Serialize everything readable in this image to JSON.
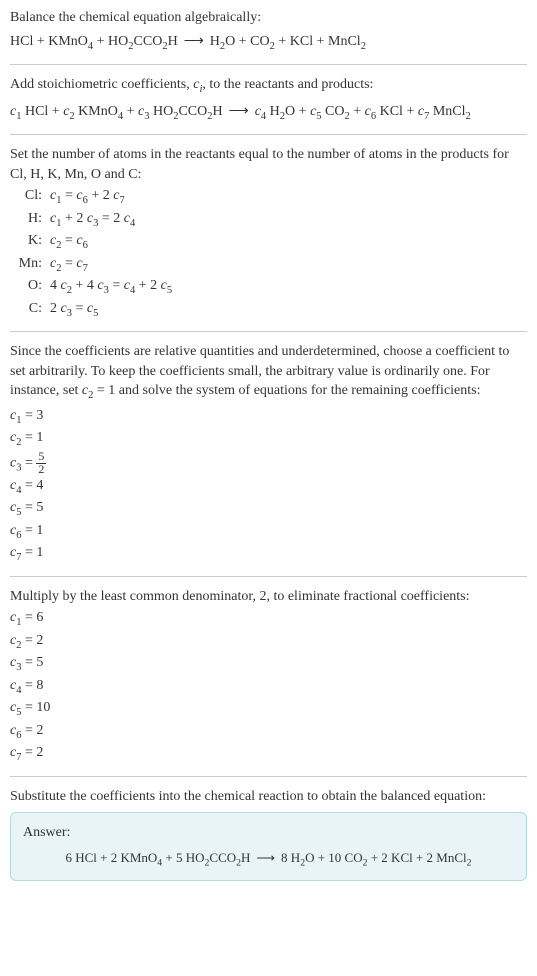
{
  "intro": {
    "line1": "Balance the chemical equation algebraically:",
    "equation": "HCl + KMnO₄ + HO₂CCO₂H ⟶ H₂O + CO₂ + KCl + MnCl₂"
  },
  "step2": {
    "line1_a": "Add stoichiometric coefficients, ",
    "line1_c": "c",
    "line1_i": "i",
    "line1_b": ", to the reactants and products:",
    "equation": "c₁ HCl + c₂ KMnO₄ + c₃ HO₂CCO₂H ⟶ c₄ H₂O + c₅ CO₂ + c₆ KCl + c₇ MnCl₂"
  },
  "step3": {
    "line1": "Set the number of atoms in the reactants equal to the number of atoms in the products for Cl, H, K, Mn, O and C:",
    "atoms": [
      {
        "label": "Cl:",
        "eq": "c₁ = c₆ + 2 c₇"
      },
      {
        "label": "H:",
        "eq": "c₁ + 2 c₃ = 2 c₄"
      },
      {
        "label": "K:",
        "eq": "c₂ = c₆"
      },
      {
        "label": "Mn:",
        "eq": "c₂ = c₇"
      },
      {
        "label": "O:",
        "eq": "4 c₂ + 4 c₃ = c₄ + 2 c₅"
      },
      {
        "label": "C:",
        "eq": "2 c₃ = c₅"
      }
    ]
  },
  "step4": {
    "text_a": "Since the coefficients are relative quantities and underdetermined, choose a coefficient to set arbitrarily. To keep the coefficients small, the arbitrary value is ordinarily one. For instance, set ",
    "text_c2": "c₂ = 1",
    "text_b": " and solve the system of equations for the remaining coefficients:",
    "coeffs": [
      "c₁ = 3",
      "c₂ = 1"
    ],
    "frac_lhs": "c₃ = ",
    "frac_num": "5",
    "frac_den": "2",
    "coeffs2": [
      "c₄ = 4",
      "c₅ = 5",
      "c₆ = 1",
      "c₇ = 1"
    ]
  },
  "step5": {
    "text": "Multiply by the least common denominator, 2, to eliminate fractional coefficients:",
    "coeffs": [
      "c₁ = 6",
      "c₂ = 2",
      "c₃ = 5",
      "c₄ = 8",
      "c₅ = 10",
      "c₆ = 2",
      "c₇ = 2"
    ]
  },
  "step6": {
    "text": "Substitute the coefficients into the chemical reaction to obtain the balanced equation:"
  },
  "answer": {
    "label": "Answer:",
    "equation": "6 HCl + 2 KMnO₄ + 5 HO₂CCO₂H ⟶ 8 H₂O + 10 CO₂ + 2 KCl + 2 MnCl₂"
  }
}
